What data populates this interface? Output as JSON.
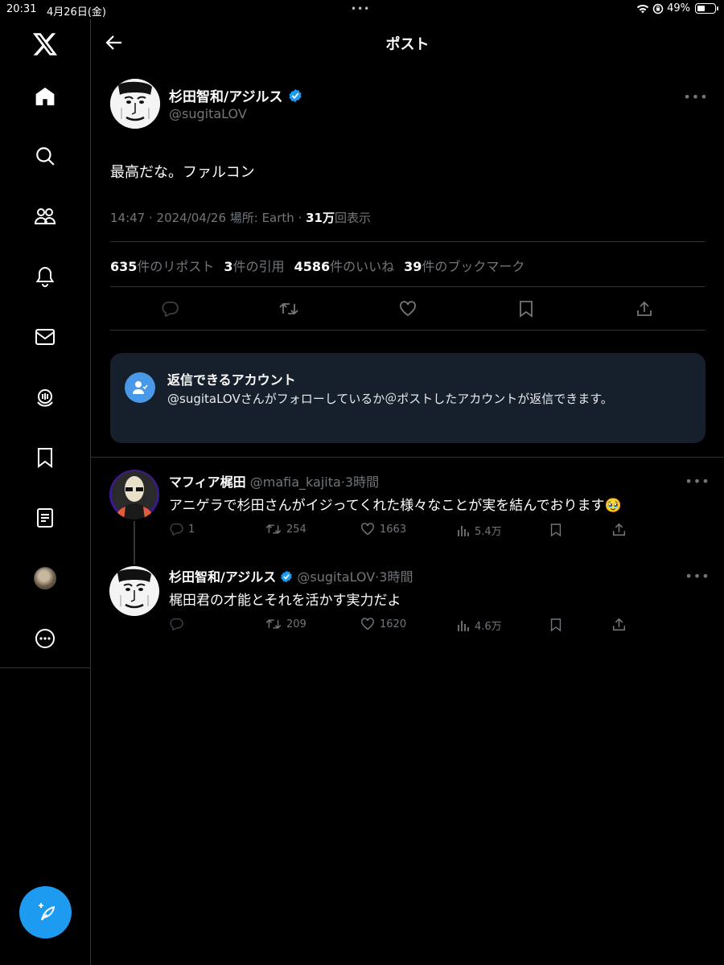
{
  "status": {
    "time": "20:31",
    "date": "4月26日(金)",
    "dots": "•••",
    "battery": "49%"
  },
  "sidebar": {
    "items": [
      {
        "name": "home"
      },
      {
        "name": "explore"
      },
      {
        "name": "communities"
      },
      {
        "name": "notifications"
      },
      {
        "name": "messages"
      },
      {
        "name": "spaces"
      },
      {
        "name": "bookmarks"
      },
      {
        "name": "lists"
      },
      {
        "name": "profile"
      },
      {
        "name": "more"
      }
    ]
  },
  "header": {
    "title": "ポスト"
  },
  "post": {
    "author_name": "杉田智和/アジルス",
    "author_handle": "@sugitaLOV",
    "text": "最高だな。ファルコン",
    "meta_prefix": "14:47 · 2024/04/26 場所: Earth · ",
    "views_count": "31万",
    "views_label": "回表示",
    "stats": [
      {
        "count": "635",
        "label": "件のリポスト"
      },
      {
        "count": "3",
        "label": "件の引用"
      },
      {
        "count": "4586",
        "label": "件のいいね"
      },
      {
        "count": "39",
        "label": "件のブックマーク"
      }
    ]
  },
  "reply_restriction": {
    "title": "返信できるアカウント",
    "description": "@sugitaLOVさんがフォローしているか＠ポストしたアカウントが返信できます。"
  },
  "replies": [
    {
      "name": "マフィア梶田",
      "handle": "@mafia_kajita",
      "time": "·3時間",
      "text": "アニゲラで杉田さんがイジってくれた様々なことが実を結んでおります🥹",
      "replies": "1",
      "retweets": "254",
      "likes": "1663",
      "views": "5.4万"
    },
    {
      "name": "杉田智和/アジルス",
      "handle": "@sugitaLOV",
      "time": "·3時間",
      "text": "梶田君の才能とそれを活かす実力だよ",
      "replies": "",
      "retweets": "209",
      "likes": "1620",
      "views": "4.6万"
    }
  ],
  "colors": {
    "accent": "#1d9bf0",
    "verified": "#1d9bf0",
    "muted": "#71767b",
    "border": "#2f3336",
    "card": "#16202c"
  }
}
